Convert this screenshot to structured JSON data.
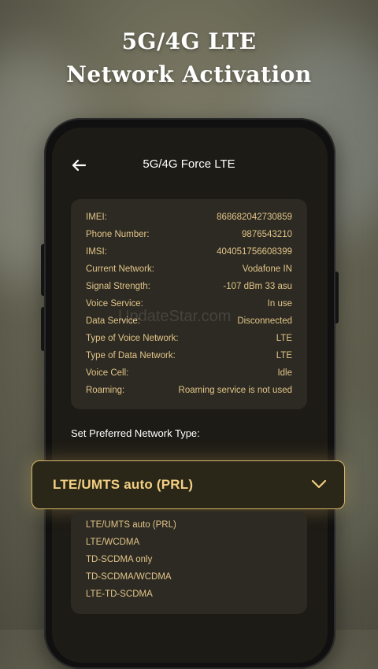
{
  "headline": {
    "line1": "5G/4G LTE",
    "line2": "Network Activation"
  },
  "app_bar": {
    "title": "5G/4G Force LTE",
    "back_icon": "back-arrow-icon"
  },
  "device_info": [
    {
      "label": "IMEI:",
      "value": "868682042730859"
    },
    {
      "label": "Phone Number:",
      "value": "9876543210"
    },
    {
      "label": "IMSI:",
      "value": "404051756608399"
    },
    {
      "label": "Current Network:",
      "value": "Vodafone IN"
    },
    {
      "label": "Signal Strength:",
      "value": "-107 dBm 33 asu"
    },
    {
      "label": "Voice Service:",
      "value": "In use"
    },
    {
      "label": "Data Service:",
      "value": "Disconnected"
    },
    {
      "label": "Type of Voice Network:",
      "value": "LTE"
    },
    {
      "label": "Type of Data Network:",
      "value": "LTE"
    },
    {
      "label": "Voice Cell:",
      "value": "Idle"
    },
    {
      "label": "Roaming:",
      "value": "Roaming service is not used"
    }
  ],
  "watermark": "UpdateStar.com",
  "network_section": {
    "label": "Set Preferred Network Type:",
    "selected": "LTE/UMTS auto (PRL)",
    "dropdown_icon": "chevron-down-icon",
    "options": [
      "LTE/UMTS auto (PRL)",
      "LTE/WCDMA",
      "TD-SCDMA only",
      "TD-SCDMA/WCDMA",
      "LTE-TD-SCDMA"
    ]
  },
  "colors": {
    "accent": "#d8b569",
    "text_gold": "#e3c58a",
    "card_bg": "#2c2a22",
    "screen_bg": "#1d1b15"
  }
}
